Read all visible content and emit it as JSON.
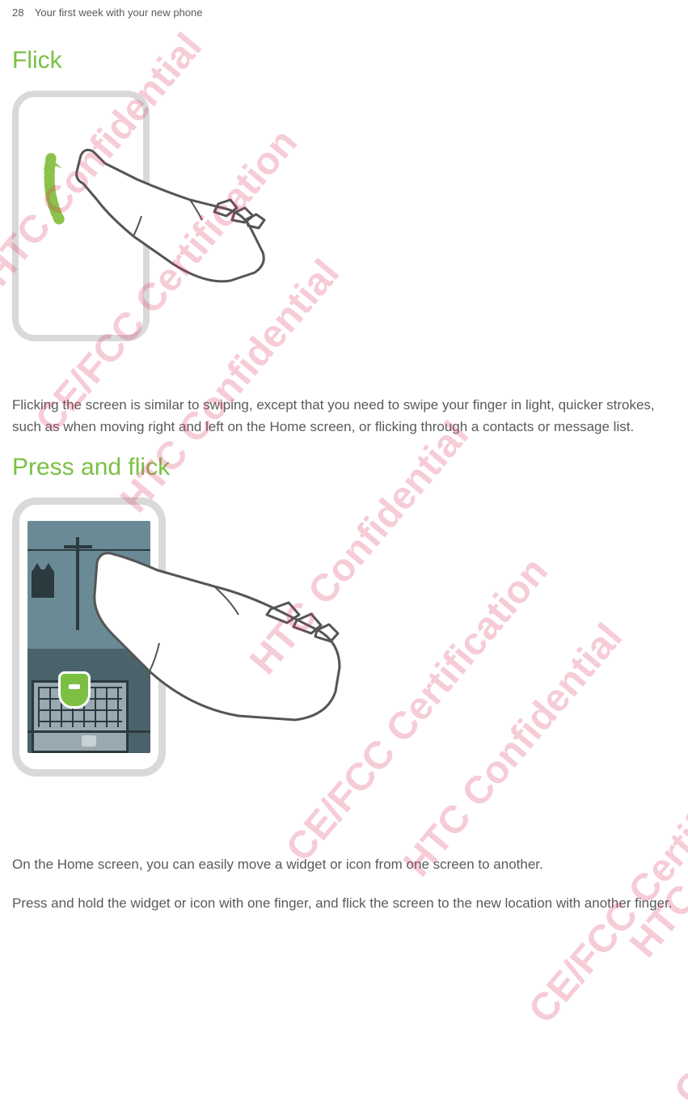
{
  "header": {
    "page_number": "28",
    "chapter": "Your first week with your new phone"
  },
  "section1": {
    "title": "Flick",
    "body": "Flicking the screen is similar to swiping, except that you need to swipe your finger in light, quicker strokes, such as when moving right and left on the Home screen, or flicking through a contacts or message list."
  },
  "section2": {
    "title": "Press and flick",
    "body1": "On the Home screen, you can easily move a widget or icon from one screen to another.",
    "body2": "Press and hold the widget or icon with one finger, and flick the screen to the new location with another finger."
  },
  "watermarks": {
    "confidential": "HTC Confidential",
    "certification": "CE/FCC Certification"
  }
}
